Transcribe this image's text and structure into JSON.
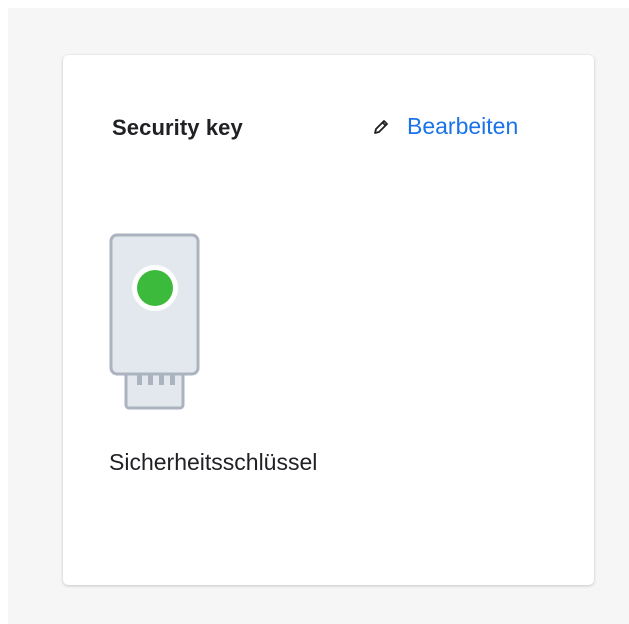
{
  "card": {
    "title": "Security key",
    "edit_label": "Bearbeiten",
    "edit_icon": "pencil-icon",
    "key_icon": "security-key-icon",
    "key_name": "Sicherheitsschlüssel"
  },
  "colors": {
    "accent": "#1a73e8",
    "status_led": "#3cba3c",
    "key_body": "#e3e8ee",
    "key_outline": "#aab3bf"
  }
}
